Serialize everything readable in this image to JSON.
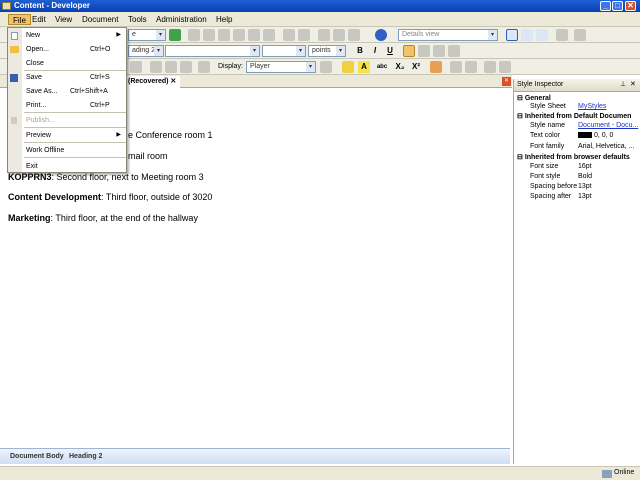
{
  "window": {
    "title": "Content - Developer"
  },
  "menubar": [
    "File",
    "Edit",
    "View",
    "Document",
    "Tools",
    "Administration",
    "Help"
  ],
  "toolbar": {
    "view_combo": "Details view",
    "style_combo": "ading 2",
    "size_unit": "points",
    "display_label": "Display:",
    "display_value": "Player"
  },
  "tab": {
    "label": "(Recovered)",
    "close": "✕"
  },
  "document": {
    "lines": [
      {
        "bold": "",
        "text": "e Conference room 1"
      },
      {
        "bold": "",
        "text": "mail room"
      },
      {
        "bold": "KOPPRN3",
        "text": ":  Second floor, next to Meeting room 3"
      },
      {
        "bold": "Content Development",
        "text": ":  Third floor, outside of 3020"
      },
      {
        "bold": "Marketing",
        "text": ":  Third floor, at the end of the hallway"
      }
    ]
  },
  "breadcrumbs": [
    "Document Body",
    "Heading 2"
  ],
  "status": {
    "connection": "Online"
  },
  "inspector": {
    "title": "Style Inspector",
    "sections": [
      {
        "name": "General",
        "props": [
          {
            "label": "Style Sheet",
            "value": "MyStyles",
            "link": true
          }
        ]
      },
      {
        "name": "Inherited from Default Documen",
        "props": [
          {
            "label": "Style name",
            "value": "Document - Docu...",
            "link": true
          },
          {
            "label": "Text color",
            "value": "0, 0, 0",
            "link": false
          },
          {
            "label": "Font family",
            "value": "Arial, Helvetica, ...",
            "link": false
          }
        ]
      },
      {
        "name": "Inherited from browser defaults",
        "props": [
          {
            "label": "Font size",
            "value": "16pt",
            "link": false
          },
          {
            "label": "Font style",
            "value": "Bold",
            "link": false
          },
          {
            "label": "Spacing before",
            "value": "13pt",
            "link": false
          },
          {
            "label": "Spacing after",
            "value": "13pt",
            "link": false
          }
        ]
      }
    ]
  },
  "file_menu": {
    "items": [
      {
        "label": "New",
        "shortcut": "",
        "submenu": true,
        "disabled": false
      },
      {
        "label": "Open...",
        "shortcut": "Ctrl+O",
        "submenu": false,
        "disabled": false
      },
      {
        "label": "Close",
        "shortcut": "",
        "submenu": false,
        "disabled": false
      },
      {
        "label": "Save",
        "shortcut": "Ctrl+S",
        "submenu": false,
        "disabled": false
      },
      {
        "label": "Save As...",
        "shortcut": "Ctrl+Shift+A",
        "submenu": false,
        "disabled": false
      },
      {
        "label": "Print...",
        "shortcut": "Ctrl+P",
        "submenu": false,
        "disabled": false
      },
      {
        "label": "Publish...",
        "shortcut": "",
        "submenu": false,
        "disabled": true
      },
      {
        "label": "Preview",
        "shortcut": "",
        "submenu": true,
        "disabled": false
      },
      {
        "label": "Work Offline",
        "shortcut": "",
        "submenu": false,
        "disabled": false
      },
      {
        "label": "Exit",
        "shortcut": "",
        "submenu": false,
        "disabled": false
      }
    ]
  },
  "colors": {
    "title_bar": "#0a3fb0",
    "menu_highlight": "#f2c36a",
    "link": "#1a35c8"
  }
}
